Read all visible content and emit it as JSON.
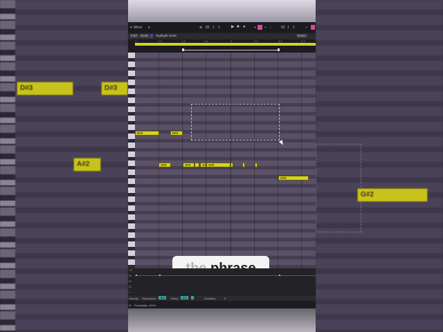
{
  "background": {
    "left_notes": [
      "D#3",
      "D#3",
      "A#2"
    ],
    "right_notes": [
      "G#2"
    ]
  },
  "transport": {
    "scale_name": "Minor",
    "tempo_pos": "65",
    "pos_a": "1",
    "pos_b": "1",
    "loop_a": "65",
    "loop_b": "1",
    "loop_c": "1"
  },
  "tabs": {
    "fold": "Fold",
    "scale": "Scale",
    "highlight": "Highlight Scale",
    "notes": "Notes"
  },
  "ruler": [
    "1",
    "1.2",
    "1.3",
    "1.4",
    "2",
    "2.2",
    "2.3",
    "2.4"
  ],
  "notes": [
    "D#3",
    "D#3",
    "A#2",
    "A#2",
    "A#",
    "A#2",
    "G#2"
  ],
  "caption": {
    "dim_word": "the",
    "word": "phrase"
  },
  "velocity": {
    "labels": [
      "127",
      "96",
      "64",
      "32",
      "1"
    ]
  },
  "params": {
    "velocity": "Velocity",
    "randomize": "Randomize",
    "randomize_val": "100",
    "ramp": "Ramp",
    "ramp_val": "100",
    "deviation": "Deviation",
    "deviation_val": "0"
  },
  "probability": {
    "label": "Probability: 100%"
  },
  "colors": {
    "note": "#d6d21e",
    "loop": "#d4d420",
    "accent_pink": "#e0449c"
  }
}
